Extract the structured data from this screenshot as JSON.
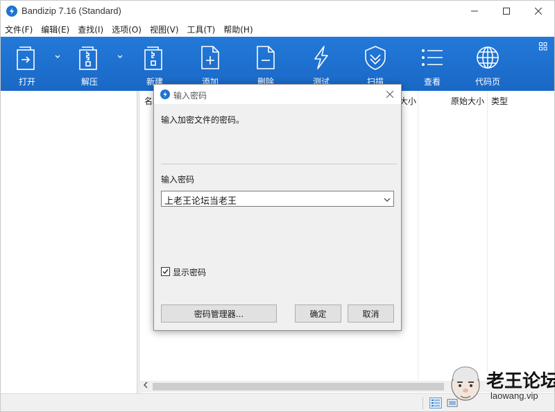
{
  "window": {
    "title": "Bandizip 7.16 (Standard)"
  },
  "menu": [
    "文件(F)",
    "编辑(E)",
    "查找(I)",
    "选项(O)",
    "视图(V)",
    "工具(T)",
    "帮助(H)"
  ],
  "toolbar": {
    "open": "打开",
    "extract": "解压",
    "new": "新建",
    "add": "添加",
    "delete": "删除",
    "test": "测试",
    "scan": "扫描",
    "view": "查看",
    "codepage": "代码页"
  },
  "list": {
    "columns": {
      "name": "名称",
      "size": "大小",
      "original_size": "原始大小",
      "type": "类型"
    }
  },
  "dialog": {
    "title": "输入密码",
    "message": "输入加密文件的密码。",
    "password_label": "输入密码",
    "password_value": "上老王论坛当老王",
    "show_password_label": "显示密码",
    "show_password_checked": true,
    "password_manager_button": "密码管理器...",
    "ok_button": "确定",
    "cancel_button": "取消"
  },
  "watermark": {
    "name": "老王论坛",
    "url": "laowang.vip"
  },
  "colors": {
    "toolbar": "#1d6fcf",
    "app_icon": "#1e73d2"
  }
}
